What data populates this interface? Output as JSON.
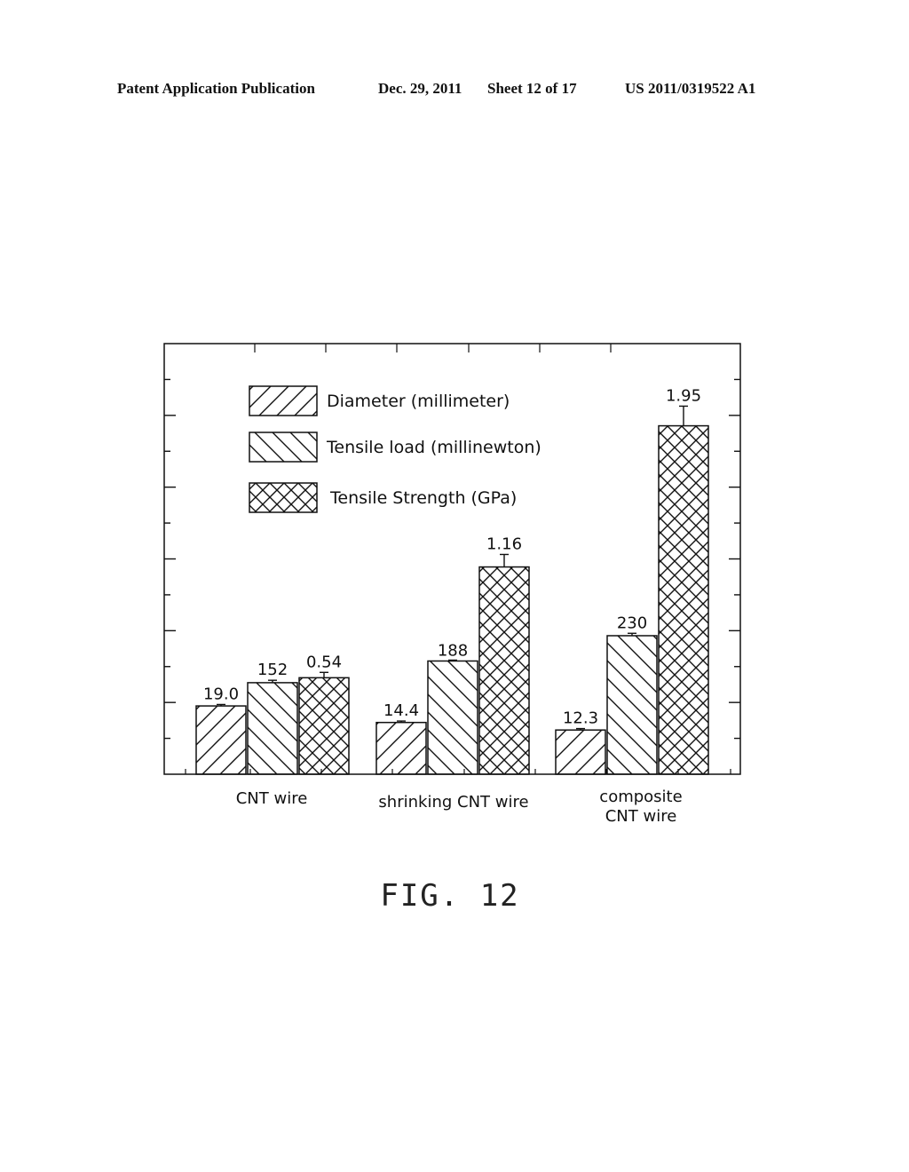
{
  "header": {
    "publication": "Patent Application Publication",
    "date": "Dec. 29, 2011",
    "sheet": "Sheet 12 of 17",
    "number": "US 2011/0319522 A1"
  },
  "figure_label": "FIG. 12",
  "chart_data": {
    "type": "bar",
    "title": "",
    "xlabel": "",
    "ylabel": "",
    "grid": false,
    "legend_position": "top-left",
    "categories": [
      "CNT wire",
      "shrinking CNT wire",
      "composite CNT wire"
    ],
    "category_lines": [
      [
        "CNT wire"
      ],
      [
        "shrinking CNT wire"
      ],
      [
        "composite",
        "CNT wire"
      ]
    ],
    "series": [
      {
        "name": "Diameter (millimeter)",
        "pattern": "forward-hatch",
        "values": [
          19.0,
          14.4,
          12.3
        ],
        "labels": [
          "19.0",
          "14.4",
          "12.3"
        ],
        "ylim": [
          0,
          119.8
        ],
        "error": [
          0.4,
          0.4,
          0.4
        ]
      },
      {
        "name": "Tensile load (millinewton)",
        "pattern": "back-hatch",
        "values": [
          152,
          188,
          230
        ],
        "labels": [
          "152",
          "188",
          "230"
        ],
        "ylim": [
          0,
          715
        ],
        "error": [
          4,
          0,
          4
        ]
      },
      {
        "name": "Tensile Strength (GPa)",
        "pattern": "cross-hatch",
        "values": [
          0.54,
          1.16,
          1.95
        ],
        "labels": [
          "0.54",
          "1.16",
          "1.95"
        ],
        "ylim": [
          0,
          2.41
        ],
        "error": [
          0.03,
          0.07,
          0.11
        ]
      }
    ]
  }
}
